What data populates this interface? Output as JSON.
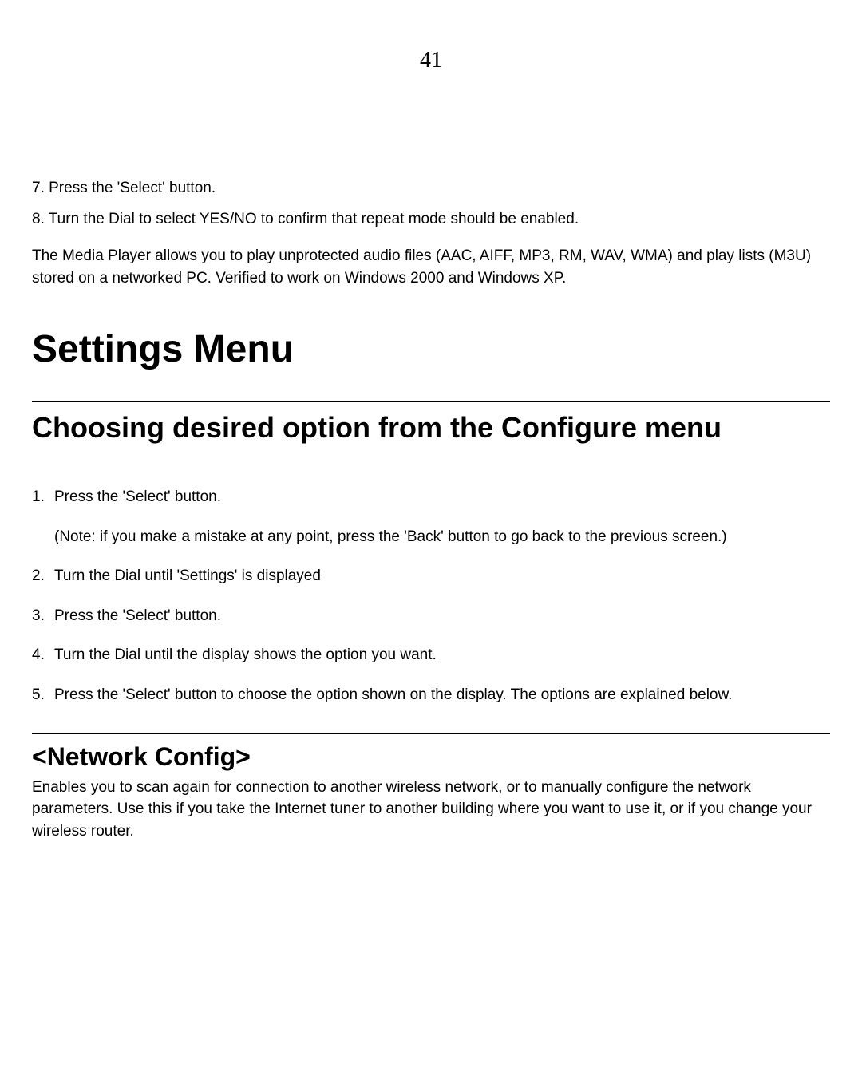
{
  "page_number": "41",
  "step7": "7. Press the 'Select' button.",
  "step8": "8. Turn the Dial to select YES/NO to confirm that repeat mode should be enabled.",
  "media_paragraph": "The Media Player allows you to play unprotected audio files (AAC, AIFF, MP3, RM, WAV, WMA) and play lists (M3U) stored on a networked PC. Verified to work on Windows 2000 and Windows XP.",
  "settings_heading": "Settings Menu",
  "configure_heading": "Choosing desired option from the Configure menu",
  "steps": {
    "n1": "1.",
    "t1": "Press the 'Select' button.",
    "note": "(Note: if you make a mistake at any point, press the 'Back' button to go back to the previous screen.)",
    "n2": "2.",
    "t2": "Turn the Dial until 'Settings' is displayed",
    "n3": "3.",
    "t3": "Press the 'Select' button.",
    "n4": "4.",
    "t4": "Turn the Dial until the display shows the option you want.",
    "n5": "5.",
    "t5": "Press the 'Select' button to choose the option shown on the display. The options are explained below."
  },
  "network_heading": "<Network Config>",
  "network_body": "Enables you to scan again for connection to another wireless network, or to manually configure the network parameters. Use this if you take the Internet tuner to another building where you want to use it, or if you change your wireless router."
}
